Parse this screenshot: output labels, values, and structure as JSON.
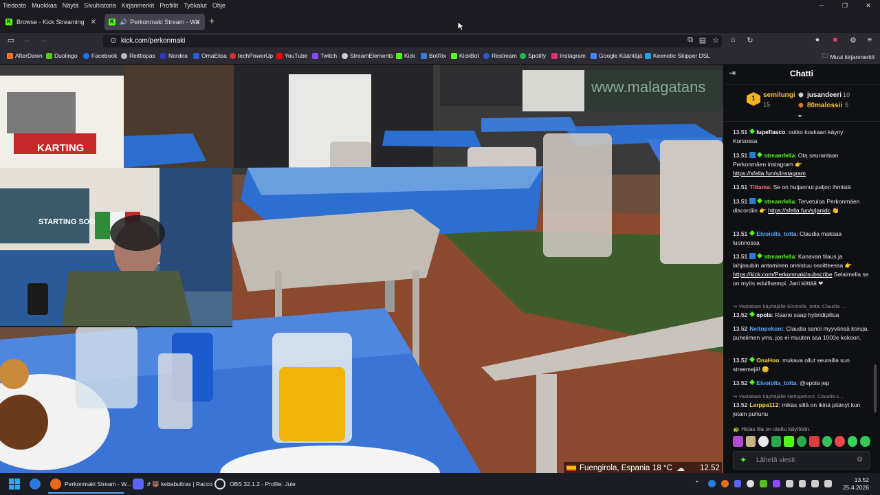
{
  "menubar": {
    "items": [
      "Tiedosto",
      "Muokkaa",
      "Näytä",
      "Sivuhistoria",
      "Kirjanmerkit",
      "Profiilit",
      "Työkalut",
      "Ohje"
    ]
  },
  "tabs": [
    {
      "label": "Browse - Kick Streaming"
    },
    {
      "label": "Perkonmaki Stream - Watch"
    }
  ],
  "nav": {
    "url": "kick.com/perkonmaki"
  },
  "bookmarks": [
    {
      "label": "AfterDawn",
      "color": "#f07030"
    },
    {
      "label": "Duolingo",
      "color": "#58cc02"
    },
    {
      "label": "Facebook",
      "color": "#1877f2"
    },
    {
      "label": "Reittiopas",
      "color": "#bbbbbb"
    },
    {
      "label": "Nordea",
      "color": "#0000a0"
    },
    {
      "label": "OmaElisa",
      "color": "#2a5cd8"
    },
    {
      "label": "techPowerUp",
      "color": "#d83030"
    },
    {
      "label": "YouTube",
      "color": "#ff0000"
    },
    {
      "label": "Twitch",
      "color": "#9146ff"
    },
    {
      "label": "StreamElements",
      "color": "#cccccc"
    },
    {
      "label": "Kick",
      "color": "#53fc18"
    },
    {
      "label": "BotRix",
      "color": "#3a7bd5"
    },
    {
      "label": "KickBot",
      "color": "#53fc18"
    },
    {
      "label": "Restream",
      "color": "#2a5cd8"
    },
    {
      "label": "Spotify",
      "color": "#1db954"
    },
    {
      "label": "Instagram",
      "color": "#e1306c"
    },
    {
      "label": "Google Kääntäjä",
      "color": "#4285f4"
    },
    {
      "label": "Keenetic Skipper DSL",
      "color": "#1aa0dc"
    }
  ],
  "other_bookmarks": "Muut kirjanmerkit",
  "video": {
    "overlay_location": "Fuengirola, Espania",
    "overlay_temp": "18 °C",
    "overlay_time": "12.52",
    "sign_text": "KARTING",
    "webcam_poster": "STARTING SOON",
    "background_sign": "www.malagatans"
  },
  "chat": {
    "title": "Chatti",
    "leaders": [
      {
        "rank": "1",
        "name": "semilungi",
        "count": "15"
      },
      {
        "name": "jusandeeri",
        "count": "10"
      },
      {
        "name": "80malossii",
        "count": "5"
      }
    ],
    "messages": [
      {
        "time": "13.51",
        "user": "lupefiasco",
        "color": "#ffffff",
        "text": ": ootko koskaan käyny Korsossa"
      },
      {
        "time": "13.51",
        "user": "streamfella",
        "color": "#53fc18",
        "text": ": Ota seurantaan Perkonmäen instagram 👉",
        "link": "https://sfella.fun/s/instagram"
      },
      {
        "time": "13.51",
        "user": "Tiitama",
        "color": "#ff7a7a",
        "text": ": Se on huijannut paljon ihmisiä"
      },
      {
        "time": "13.51",
        "user": "streamfella",
        "color": "#53fc18",
        "text": ": Tervetuloa Perkonmäen discordiin 👉",
        "link": "https://sfella.fun/s/janidc",
        "after": " 👏"
      },
      {
        "time": "13.51",
        "user": "Eivoiolla_totta",
        "color": "#5aa8ff",
        "text": ": Claudia maksaa luonnossa"
      },
      {
        "time": "13.51",
        "user": "streamfella",
        "color": "#53fc18",
        "text": ": Kanavan tilaus ja lahjasubin antaminen onnistuu osoitteessa 👉",
        "link": "https://kick.com/Perkonmaki/subscribe",
        "after": " Selaimella se on myös edullisempi. Jani kiittää ❤"
      },
      {
        "reply": "↪ Vastataan käyttäjälle Eivoiolla_totta: Claudia ..."
      },
      {
        "time": "13.52",
        "user": "epola",
        "color": "#ffffff",
        "text": ": Raano saap hybridipillua"
      },
      {
        "time": "13.52",
        "user": "Neitopekoni",
        "color": "#5aa8ff",
        "text": ": Claudia sanoi myyvänsä koruja, puhelimen yms. jos ei muuten saa 1000e kokoon."
      },
      {
        "time": "13.52",
        "user": "OnaHoo",
        "color": "#ffd84a",
        "text": ": mukava ollut seurailla sun streemejä! 😊"
      },
      {
        "time": "13.52",
        "user": "Eivoiolla_totta",
        "color": "#5aa8ff",
        "text": ": @epola jep"
      },
      {
        "reply": "↪ Vastataan käyttäjälle Neitopekoni: Claudia s..."
      },
      {
        "time": "13.52",
        "user": "Lerppa112",
        "color": "#ffd84a",
        "text": ": mikäs sillä on ikinä pitänyt kun jotain puhunu"
      }
    ],
    "slow_mode": "Hidas tila on otettu käyttöön.",
    "input_placeholder": "Lähetä viesti"
  },
  "taskbar": {
    "items": [
      "Perkonmaki Stream - W...",
      "# 🐻 kebabultras | Racco",
      "OBS 32.1.2 - Profile: Jule"
    ],
    "time": "13.52",
    "date": "25.4.2026"
  }
}
